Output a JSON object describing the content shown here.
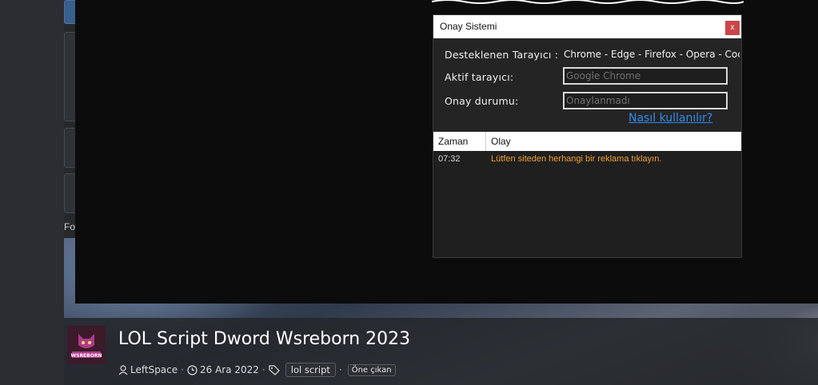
{
  "dialog": {
    "title": "Onay Sistemi",
    "close_label": "x",
    "supported_label": "Desteklenen Tarayıcı :",
    "supported_value": "Chrome - Edge - Firefox - Opera - Coc",
    "active_label": "Aktif tarayıcı:",
    "active_value": "Google Chrome",
    "status_label": "Onay durumu:",
    "status_value": "Onaylanmadı",
    "help_link": "Nasıl kullanılır?",
    "log": {
      "columns": [
        "Zaman",
        "Olay"
      ],
      "rows": [
        {
          "time": "07:32",
          "event": "Lütfen siteden herhangi bir reklama tıklayın."
        }
      ]
    }
  },
  "page": {
    "side_fragment": "Fo",
    "post_title": "LOL Script Dword Wsreborn 2023",
    "avatar_text": "WSREBORN",
    "author": "LeftSpace",
    "date": "26 Ara 2022",
    "tags": [
      "lol script",
      "Öne çıkan"
    ],
    "separator": "·"
  },
  "colors": {
    "accent_link": "#2e8cf0",
    "event_text": "#f0a030",
    "close_button": "#c8464a"
  }
}
